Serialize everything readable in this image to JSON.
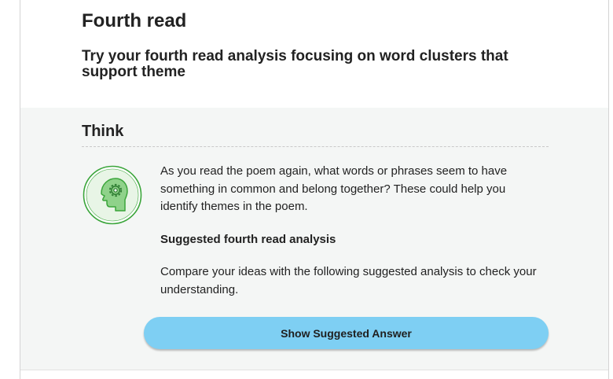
{
  "header": {
    "title": "Fourth read",
    "subtitle": "Try your fourth read analysis focusing on word clusters that support theme"
  },
  "think": {
    "heading": "Think",
    "icon": "head-gear-icon",
    "prompt": "As you read the poem again, what words or phrases seem to have something in common and belong together? These could help you identify themes in the poem.",
    "suggested_heading": "Suggested fourth read analysis",
    "compare_text": "Compare your ideas with the following suggested analysis to check your understanding.",
    "button_label": "Show Suggested Answer"
  },
  "colors": {
    "section_background": "#f4f6f5",
    "button": "#7ecff3",
    "icon_green": "#3aa53a",
    "icon_light_green": "#8fd28a"
  }
}
